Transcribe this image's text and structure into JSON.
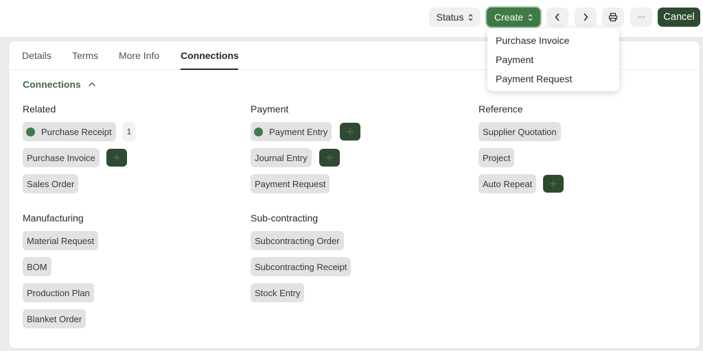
{
  "toolbar": {
    "status_label": "Status",
    "create_label": "Create",
    "more_label": "···",
    "cancel_label": "Cancel"
  },
  "tabs": [
    "Details",
    "Terms",
    "More Info",
    "Connections"
  ],
  "active_tab": "Connections",
  "connections": {
    "title": "Connections",
    "groups": {
      "related": {
        "title": "Related",
        "items": [
          "Purchase Receipt",
          "Purchase Invoice",
          "Sales Order"
        ],
        "purchase_receipt_count": "1"
      },
      "payment": {
        "title": "Payment",
        "items": [
          "Payment Entry",
          "Journal Entry",
          "Payment Request"
        ]
      },
      "reference": {
        "title": "Reference",
        "items": [
          "Supplier Quotation",
          "Project",
          "Auto Repeat"
        ]
      },
      "manufacturing": {
        "title": "Manufacturing",
        "items": [
          "Material Request",
          "BOM",
          "Production Plan",
          "Blanket Order"
        ]
      },
      "subcontracting": {
        "title": "Sub-contracting",
        "items": [
          "Subcontracting Order",
          "Subcontracting Receipt",
          "Stock Entry"
        ]
      }
    }
  },
  "create_menu": [
    "Purchase Invoice",
    "Payment",
    "Payment Request"
  ],
  "colors": {
    "accent": "#3f7a47",
    "dark_button": "#2d4b30",
    "pill_bg": "#e2e2e2"
  }
}
